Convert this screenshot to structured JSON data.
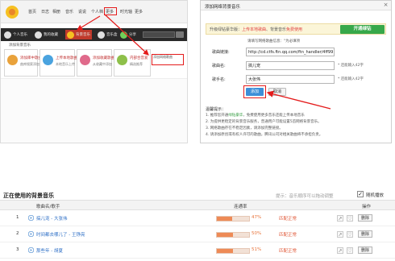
{
  "site": {
    "nav": [
      "首页",
      "日志",
      "相册",
      "音乐",
      "说说",
      "个人档",
      "更多",
      "时光轴",
      "更多"
    ],
    "toolbar": [
      "个人音乐",
      "我的收藏",
      "背景音乐",
      "音乐盒",
      "分享"
    ],
    "quick_label": "添加背景音乐",
    "cards": [
      {
        "title": "添加库中歌曲",
        "sub": "曲库搜索添加"
      },
      {
        "title": "上传本地歌曲",
        "sub": "本地音乐上传"
      },
      {
        "title": "添加收藏歌曲",
        "sub": "从收藏中添加"
      },
      {
        "title": "内部合音爱",
        "sub": "精选推荐"
      },
      {
        "title": "添加网络歌曲",
        "sub": "网络链接添加"
      }
    ],
    "highlight_label": "添加网络背景\n音乐"
  },
  "dialog": {
    "title": "添加网络背景音乐",
    "close": "×",
    "upgrade_prefix": "升级绿钻豪华版：",
    "upgrade_red1": "上传本地歌曲",
    "upgrade_mid": "、背景音乐",
    "upgrade_red2": "免费使用",
    "upgrade_button": "开通绿钻",
    "hint": "请填写网络歌曲信息：\"为必填项",
    "fields": [
      {
        "label": "歌曲链接:",
        "value": "http://cd.ctfs.ftn.qq.com/ftn_handler/4ff99",
        "note": ""
      },
      {
        "label": "歌曲名:",
        "value": "搞儿宠",
        "note": "* 还能输入42字"
      },
      {
        "label": "歌手名:",
        "value": "大张伟",
        "note": "* 还能输入42字"
      }
    ],
    "add_button": "添加",
    "cancel_button": "取消",
    "tips_title": "温馨提示：",
    "tips": [
      {
        "a": "1. 推荐您开通",
        "b": "绿钻豪华",
        "c": "，免费使用更多音乐还能上传本地音乐"
      },
      {
        "a": "2. 为提供更稳定的背景音乐服务，普通用户可能设置5首网络背景音乐。",
        "b": "",
        "c": ""
      },
      {
        "a": "3. 网络歌曲存在不稳定因素，请添加完整链接。",
        "b": "",
        "c": ""
      },
      {
        "a": "4. 请添加原创或有权人许可的歌曲，腾讯公司对相关歌曲将不承担负责。",
        "b": "",
        "c": ""
      }
    ]
  },
  "now_playing": {
    "title": "正在使用的背景音乐",
    "sort_hint": "提示：音乐顺序可以拖动调整",
    "random_label": "随机播放",
    "random_checked": "✓",
    "headers": {
      "song": "歌曲名/歌手",
      "rate": "连通率",
      "action": "操作"
    },
    "rows": [
      {
        "num": "1",
        "song": "搞儿宠 - 大张伟",
        "percent": 47,
        "percent_label": "47%",
        "status": "匹配正常",
        "delete": "删除"
      },
      {
        "num": "2",
        "song": "时间都去哪儿了 - 王铮亮",
        "percent": 50,
        "percent_label": "50%",
        "status": "匹配正常",
        "delete": "删除"
      },
      {
        "num": "3",
        "song": "那些年 - 胡夏",
        "percent": 51,
        "percent_label": "51%",
        "status": "匹配正常",
        "delete": "删除"
      }
    ]
  },
  "colors": {
    "accent_green": "#37a84a",
    "progress": "#ee8a56",
    "highlight_red": "#e41b1b",
    "link_blue": "#2e6fc6"
  }
}
